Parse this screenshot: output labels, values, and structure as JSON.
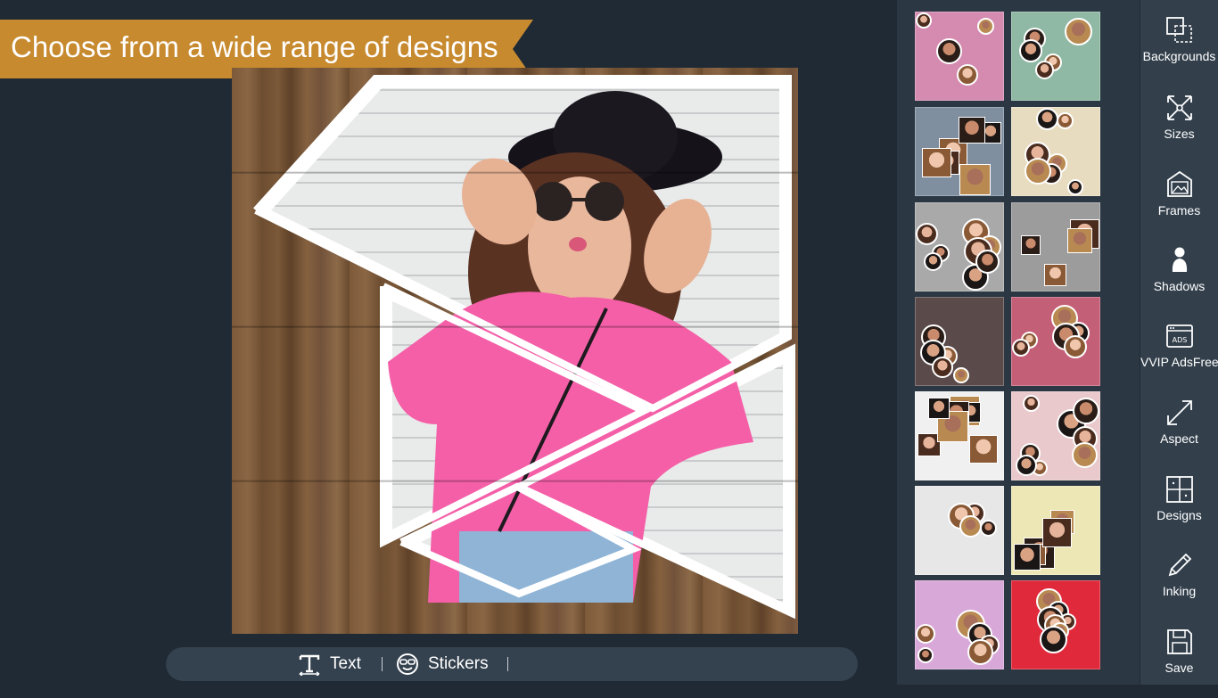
{
  "banner": {
    "text": "Choose from a wide range of designs",
    "color": "#c78a2f"
  },
  "toolbar": {
    "text_label": "Text",
    "stickers_label": "Stickers"
  },
  "sidebar": {
    "items": [
      {
        "label": "Backgrounds",
        "icon": "backgrounds-icon"
      },
      {
        "label": "Sizes",
        "icon": "sizes-icon"
      },
      {
        "label": "Frames",
        "icon": "frames-icon"
      },
      {
        "label": "Shadows",
        "icon": "shadows-icon"
      },
      {
        "label": "VVIP AdsFree",
        "icon": "ads-icon"
      },
      {
        "label": "Aspect",
        "icon": "aspect-icon"
      },
      {
        "label": "Designs",
        "icon": "designs-icon"
      },
      {
        "label": "Inking",
        "icon": "pencil-icon"
      },
      {
        "label": "Save",
        "icon": "save-icon"
      }
    ]
  },
  "thumbnails": {
    "backgrounds": [
      "#d58bb0",
      "#8fb9a4",
      "#7f8fa0",
      "#e8dcc0",
      "#a9a9a9",
      "#9c9c9c",
      "#5a4a4a",
      "#c45f78",
      "#f0f0f0",
      "#e9c9cb",
      "#e7e7e7",
      "#ece7b4",
      "#d8a8d8",
      "#e02a3c"
    ]
  },
  "colors": {
    "background": "#1f2a35",
    "panel": "#2b3743",
    "sidebar": "#33404c",
    "toolbar": "#34414e"
  }
}
